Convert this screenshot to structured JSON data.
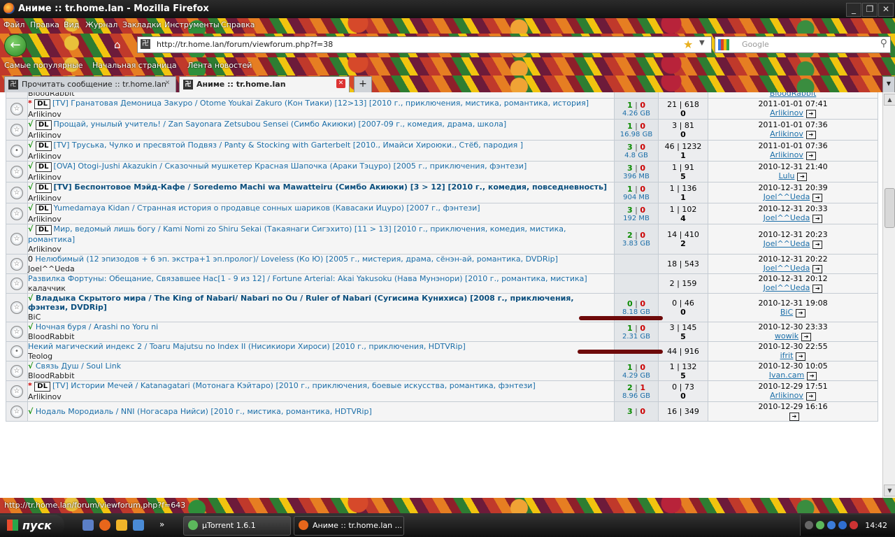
{
  "window": {
    "title": "Аниме :: tr.home.lan - Mozilla Firefox"
  },
  "menu": [
    "Файл",
    "Правка",
    "Вид",
    "Журнал",
    "Закладки",
    "Инструменты",
    "Справка"
  ],
  "url": "http://tr.home.lan/forum/viewforum.php?f=38",
  "search": {
    "placeholder": "Google"
  },
  "bookmarks": [
    "Самые популярные",
    "Начальная страница",
    "Лента новостей"
  ],
  "tabs": [
    {
      "label": "Прочитать сообщение :: tr.home.lan"
    },
    {
      "label": "Аниме :: tr.home.lan"
    }
  ],
  "partial_top": {
    "author": "BloodRabbit",
    "lastpost_user": "BloodRabbit"
  },
  "topics": [
    {
      "icon": "star",
      "status": "*",
      "dl": "DL",
      "title": "[TV] Гранатовая Демоница Закуро / Otome Youkai Zakuro (Кон Тиаки) [12>13] [2010 г., приключения, мистика, романтика, история]",
      "title_bold": false,
      "author": "Arlikinov",
      "seeds": "1",
      "leech": "0",
      "size": "4.26 GB",
      "replies": "21 | 618",
      "downloads": "0",
      "date": "2011-01-01 07:41",
      "user": "Arlikinov"
    },
    {
      "icon": "star",
      "status": "√",
      "dl": "DL",
      "title": "Прощай, унылый учитель! / Zan Sayonara Zetsubou Sensei (Симбо Акиюки) [2007-09 г., комедия, драма, школа]",
      "title_bold": false,
      "author": "Arlikinov",
      "seeds": "1",
      "leech": "0",
      "size": "16.98 GB",
      "replies": "3 | 81",
      "downloads": "0",
      "date": "2011-01-01 07:36",
      "user": "Arlikinov"
    },
    {
      "icon": "dot",
      "status": "√",
      "dl": "DL",
      "title": "[TV] Труська, Чулко и пресвятой Подвяз / Panty & Stocking with Garterbelt [2010., Имайси Хироюки., Стёб, пародия ]",
      "title_bold": false,
      "author": "Arlikinov",
      "seeds": "3",
      "leech": "0",
      "size": "4.8 GB",
      "replies": "46 | 1232",
      "downloads": "1",
      "date": "2011-01-01 07:36",
      "user": "Arlikinov"
    },
    {
      "icon": "star",
      "status": "√",
      "dl": "DL",
      "title": "[OVA] Otogi-Jushi Akazukin / Сказочный мушкетер Красная Шапочка (Араки Тэцуро) [2005 г., приключения, фэнтези]",
      "title_bold": false,
      "author": "Arlikinov",
      "seeds": "3",
      "leech": "0",
      "size": "396 MB",
      "replies": "1 | 91",
      "downloads": "5",
      "date": "2010-12-31 21:40",
      "user": "Lulu"
    },
    {
      "icon": "star",
      "status": "√",
      "dl": "DL",
      "title": "[TV] Беспонтовое Мэйд-Кафе / Soredemo Machi wa Mawatteiru (Симбо Акиюки) [3 > 12] [2010 г., комедия, повседневность]",
      "title_bold": true,
      "author": "Arlikinov",
      "seeds": "1",
      "leech": "0",
      "size": "904 MB",
      "replies": "1 | 136",
      "downloads": "1",
      "date": "2010-12-31 20:39",
      "user": "Joel^^Ueda"
    },
    {
      "icon": "star",
      "status": "√",
      "dl": "DL",
      "title": "Yumedamaya Kidan / Странная история о продавце сонных шариков (Кавасаки Ицуро) [2007 г., фэнтези]",
      "title_bold": false,
      "author": "Arlikinov",
      "seeds": "3",
      "leech": "0",
      "size": "192 MB",
      "replies": "1 | 102",
      "downloads": "4",
      "date": "2010-12-31 20:33",
      "user": "Joel^^Ueda"
    },
    {
      "icon": "star",
      "status": "√",
      "dl": "DL",
      "title": "Мир, ведомый лишь богу / Kami Nomi zo Shiru Sekai (Такаянаги Сигэхито) [11 > 13] [2010 г., приключения, комедия, мистика, романтика]",
      "title_bold": false,
      "author": "Arlikinov",
      "seeds": "2",
      "leech": "0",
      "size": "3.83 GB",
      "replies": "14 | 410",
      "downloads": "2",
      "date": "2010-12-31 20:23",
      "user": "Joel^^Ueda"
    },
    {
      "icon": "star",
      "status": "",
      "dl": "",
      "attach": "0",
      "title": "Нелюбимый (12 эпизодов + 6 эп. экстра+1 эп.пролог)/ Loveless (Ко Ю) [2005 г., мистерия, драма, сёнэн-ай, романтика, DVDRip]",
      "title_bold": false,
      "author": "Joel^^Ueda",
      "seeds": "",
      "leech": "",
      "size": "",
      "replies": "18 | 543",
      "downloads": "",
      "date": "2010-12-31 20:22",
      "user": "Joel^^Ueda",
      "scrawl": true
    },
    {
      "icon": "star",
      "status": "",
      "dl": "",
      "title": "Развилка Фортуны: Обещание, Связавшее Нас[1 - 9 из 12] / Fortune Arterial: Akai Yakusoku (Нава Мунэнори) [2010 г., романтика, мистика]",
      "title_bold": false,
      "author": "калаччик",
      "seeds": "",
      "leech": "",
      "size": "",
      "replies": "2 | 159",
      "downloads": "",
      "date": "2010-12-31 20:12",
      "user": "Joel^^Ueda",
      "scrawl": true
    },
    {
      "icon": "star",
      "status": "√",
      "dl": "",
      "title": "Владыка Скрытого мира / The King of Nabari/ Nabari no Ou / Ruler of Nabari (Сугисима Кунихиса) [2008 г., приключения, фэнтези, DVDRip]",
      "title_bold": true,
      "author": "BiC",
      "seeds": "0",
      "leech": "0",
      "size": "8.18 GB",
      "replies": "0 | 46",
      "downloads": "0",
      "date": "2010-12-31 19:08",
      "user": "BiC"
    },
    {
      "icon": "star",
      "status": "√",
      "dl": "",
      "title": "Ночная буря / Arashi no Yoru ni",
      "title_bold": false,
      "author": "BloodRabbit",
      "seeds": "1",
      "leech": "0",
      "size": "2.31 GB",
      "replies": "3 | 145",
      "downloads": "5",
      "date": "2010-12-30 23:33",
      "user": "wowik"
    },
    {
      "icon": "dot",
      "status": "",
      "dl": "",
      "title": "Некий магический индекс 2 / Toaru Majutsu no Index II (Нисикиори Хироси) [2010 г., приключения, HDTVRip]",
      "title_bold": false,
      "author": "Teolog",
      "seeds": "",
      "leech": "",
      "size": "",
      "replies": "44 | 916",
      "downloads": "",
      "date": "2010-12-30 22:55",
      "user": "ifrit"
    },
    {
      "icon": "star",
      "status": "√",
      "dl": "",
      "title": "Связь Душ / Soul Link",
      "title_bold": false,
      "author": "BloodRabbit",
      "seeds": "1",
      "leech": "0",
      "size": "4.29 GB",
      "replies": "1 | 132",
      "downloads": "5",
      "date": "2010-12-30 10:05",
      "user": "Ivan.cam"
    },
    {
      "icon": "star",
      "status": "*",
      "dl": "DL",
      "title": "[TV] Истории Мечей / Katanagatari (Мотонага Кэйтаро) [2010 г., приключения, боевые искусства, романтика, фэнтези]",
      "title_bold": false,
      "author": "Arlikinov",
      "seeds": "2",
      "leech": "1",
      "size": "8.96 GB",
      "replies": "0 | 73",
      "downloads": "0",
      "date": "2010-12-29 17:51",
      "user": "Arlikinov"
    },
    {
      "icon": "star",
      "status": "√",
      "dl": "",
      "title": "Нодаль Мородиаль / NNI (Ногасара Нийси) [2010 г., мистика, романтика, HDTVRip]",
      "title_bold": false,
      "author": "",
      "seeds": "3",
      "leech": "0",
      "size": "",
      "replies": "16 | 349",
      "downloads": "",
      "date": "2010-12-29 16:16",
      "user": ""
    }
  ],
  "statusbar": {
    "text": "http://tr.home.lan/forum/viewforum.php?f=643"
  },
  "taskbar": {
    "start": "пуск",
    "tasks": [
      "µTorrent 1.6.1",
      "Аниме :: tr.home.lan ..."
    ],
    "clock": "14:42"
  }
}
